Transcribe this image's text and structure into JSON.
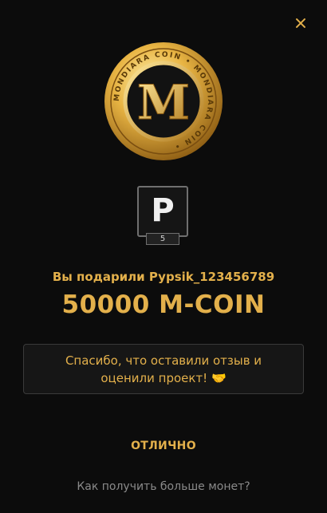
{
  "close_icon": "close-icon",
  "coin": {
    "letter": "M",
    "ring_text": "MONDIARA COIN • MONDIARA COIN • "
  },
  "badge": {
    "letter": "P",
    "level": "5"
  },
  "gift": {
    "text": "Вы подарили Pypsik_123456789"
  },
  "amount": "50000 M-COIN",
  "thanks": {
    "line1": "Спасибо, что оставили отзыв и",
    "line2": "оценили проект! 🤝"
  },
  "ok_button": "ОТЛИЧНО",
  "more_link": "Как получить больше монет?",
  "colors": {
    "accent": "#e3b04b",
    "background": "#0c0c0c",
    "muted": "#8a8a8a"
  }
}
